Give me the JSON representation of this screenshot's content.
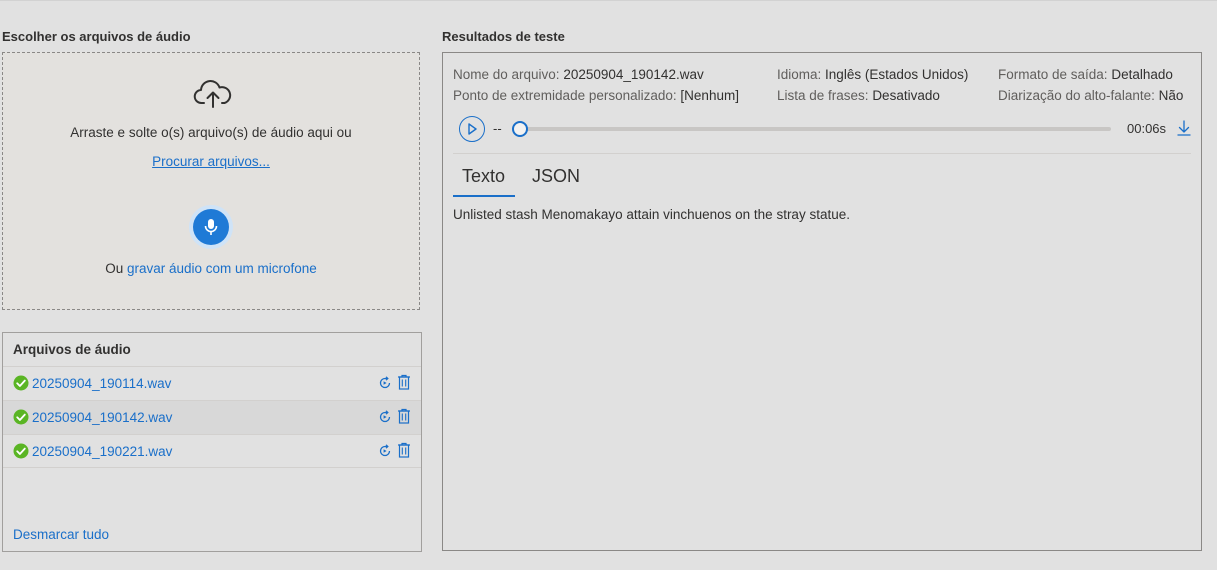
{
  "left": {
    "title": "Escolher os arquivos de áudio",
    "dropzone": {
      "icon": "cloud-upload-icon",
      "drag_text": "Arraste e solte o(s) arquivo(s) de áudio aqui ou",
      "browse_label": "Procurar arquivos...",
      "mic_icon": "microphone-icon",
      "record_prefix": "Ou ",
      "record_link": "gravar áudio com um microfone"
    },
    "files": {
      "title": "Arquivos de áudio",
      "items": [
        {
          "name": "20250904_190114.wav",
          "status": "success",
          "selected": false
        },
        {
          "name": "20250904_190142.wav",
          "status": "success",
          "selected": true
        },
        {
          "name": "20250904_190221.wav",
          "status": "success",
          "selected": false
        }
      ],
      "deselect_label": "Desmarcar tudo"
    }
  },
  "results": {
    "title": "Resultados de teste",
    "meta": {
      "file_name": {
        "label": "Nome do arquivo:",
        "value": "20250904_190142.wav"
      },
      "language": {
        "label": "Idioma:",
        "value": "Inglês (Estados Unidos)"
      },
      "output_format": {
        "label": "Formato de saída:",
        "value": "Detalhado"
      },
      "endpoint": {
        "label": "Ponto de extremidade personalizado:",
        "value": "[Nenhum]"
      },
      "phrase_list": {
        "label": "Lista de frases:",
        "value": "Desativado"
      },
      "diarization": {
        "label": "Diarização do alto-falante:",
        "value": "Não"
      }
    },
    "player": {
      "current_time": "--",
      "duration": "00:06s",
      "progress": 0
    },
    "tabs": [
      {
        "label": "Texto",
        "active": true
      },
      {
        "label": "JSON",
        "active": false
      }
    ],
    "transcript": "Unlisted stash Menomakayo attain vinchuenos on the stray statue."
  },
  "colors": {
    "accent": "#1a6fc9",
    "success": "#5ab524",
    "background": "#e1e1e1"
  }
}
